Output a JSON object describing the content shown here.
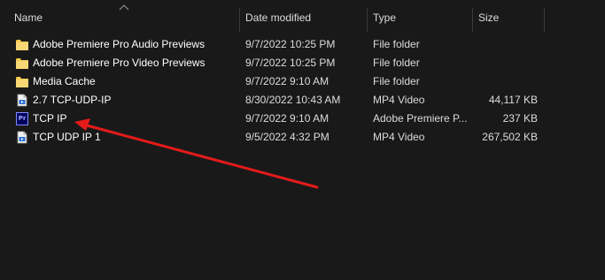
{
  "columns": {
    "name": "Name",
    "date_modified": "Date modified",
    "type": "Type",
    "size": "Size"
  },
  "sort": {
    "column": "name",
    "direction": "ascending"
  },
  "files": [
    {
      "name": "Adobe Premiere Pro Audio Previews",
      "date": "9/7/2022 10:25 PM",
      "type": "File folder",
      "size": "",
      "icon": "folder-icon"
    },
    {
      "name": "Adobe Premiere Pro Video Previews",
      "date": "9/7/2022 10:25 PM",
      "type": "File folder",
      "size": "",
      "icon": "folder-icon"
    },
    {
      "name": "Media Cache",
      "date": "9/7/2022 9:10 AM",
      "type": "File folder",
      "size": "",
      "icon": "folder-icon"
    },
    {
      "name": "2.7 TCP-UDP-IP",
      "date": "8/30/2022 10:43 AM",
      "type": "MP4 Video",
      "size": "44,117 KB",
      "icon": "video-file-icon"
    },
    {
      "name": "TCP IP",
      "date": "9/7/2022 9:10 AM",
      "type": "Adobe Premiere P...",
      "size": "237 KB",
      "icon": "premiere-pro-icon"
    },
    {
      "name": "TCP UDP IP 1",
      "date": "9/5/2022 4:32 PM",
      "type": "MP4 Video",
      "size": "267,502 KB",
      "icon": "video-file-icon"
    }
  ],
  "colors": {
    "background": "#191919",
    "folder": "#f4c94f",
    "annotation_arrow": "#e31b1b"
  },
  "annotation": {
    "type": "arrow",
    "points_to": "TCP IP"
  }
}
